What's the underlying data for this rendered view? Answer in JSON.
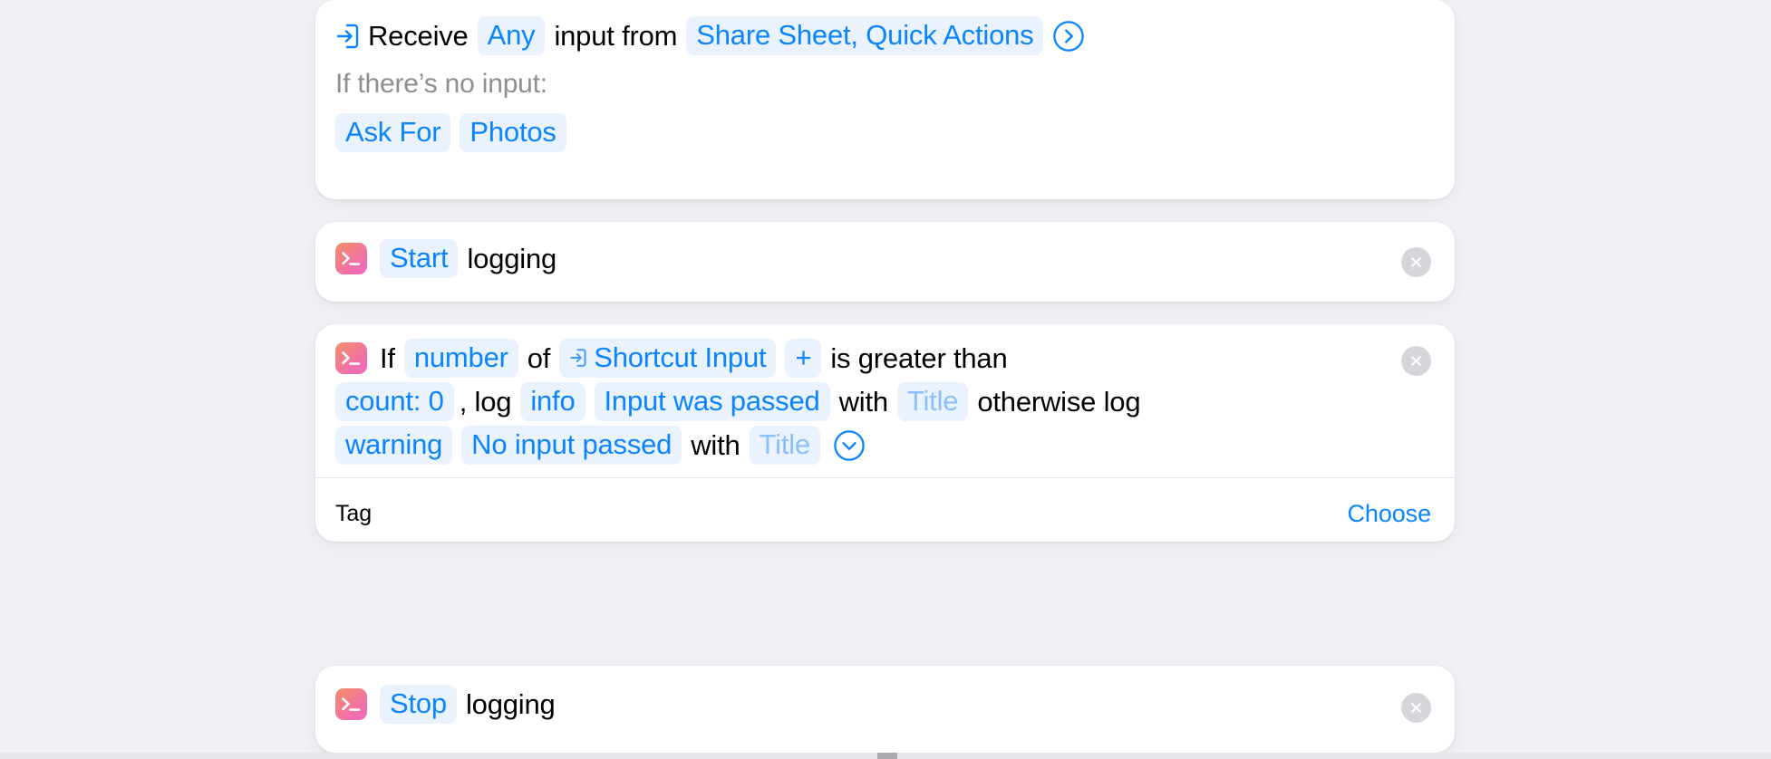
{
  "theme": {
    "page_background": "#f1f1f5",
    "card_background": "#ffffff",
    "accent_blue": "#0a84ff",
    "token_background": "#eaf2fd",
    "placeholder_blue": "#8cc0f8",
    "muted_text": "#8e8e93",
    "remove_button_fill": "#d6d6da",
    "app_icon_gradient_start": "#f3906b",
    "app_icon_gradient_end": "#f06cb8"
  },
  "cards": [
    {
      "id": "shortcut-input-card",
      "icon": "shortcut-input-arrow-icon",
      "line1": [
        {
          "type": "icon",
          "name": "shortcut-input-arrow-icon"
        },
        {
          "type": "plain",
          "text": "Receive"
        },
        {
          "type": "token",
          "text": "Any"
        },
        {
          "type": "plain",
          "text": "input from"
        },
        {
          "type": "token",
          "text": "Share Sheet, Quick Actions"
        },
        {
          "type": "icon",
          "name": "chevron-right-circle-icon"
        }
      ],
      "no_input_label": "If there’s no input:",
      "no_input_tokens": [
        {
          "type": "token",
          "text": "Ask For"
        },
        {
          "type": "token",
          "text": "Photos"
        }
      ]
    },
    {
      "id": "start-logging-card",
      "icon": "terminal-app-icon",
      "tokens": [
        {
          "type": "token",
          "text": "Start"
        },
        {
          "type": "plain",
          "text": "logging"
        }
      ],
      "remove_label": "×"
    },
    {
      "id": "if-log-card",
      "icon": "terminal-app-icon",
      "lines": [
        [
          {
            "type": "appicon",
            "name": "terminal-app-icon"
          },
          {
            "type": "plain",
            "text": "If"
          },
          {
            "type": "token",
            "text": "number"
          },
          {
            "type": "plain",
            "text": "of"
          },
          {
            "type": "token",
            "text": "Shortcut Input",
            "glyph": "shortcut-input-arrow-icon"
          },
          {
            "type": "token",
            "text": "+"
          },
          {
            "type": "plain",
            "text": "is greater than"
          }
        ],
        [
          {
            "type": "token",
            "text": "count: 0"
          },
          {
            "type": "plain",
            "text": ", log"
          },
          {
            "type": "token",
            "text": "info"
          },
          {
            "type": "token",
            "text": "Input was passed"
          },
          {
            "type": "plain",
            "text": "with"
          },
          {
            "type": "token",
            "text": "Title",
            "placeholder": true
          },
          {
            "type": "plain",
            "text": "otherwise log"
          }
        ],
        [
          {
            "type": "token",
            "text": "warning"
          },
          {
            "type": "token",
            "text": "No input passed"
          },
          {
            "type": "plain",
            "text": "with"
          },
          {
            "type": "token",
            "text": "Title",
            "placeholder": true
          },
          {
            "type": "icon",
            "name": "chevron-down-circle-icon"
          }
        ]
      ],
      "detail": {
        "label": "Tag",
        "action": "Choose"
      },
      "remove_label": "×"
    },
    {
      "id": "stop-logging-card",
      "icon": "terminal-app-icon",
      "tokens": [
        {
          "type": "token",
          "text": "Stop"
        },
        {
          "type": "plain",
          "text": "logging"
        }
      ],
      "remove_label": "×"
    }
  ],
  "text": {
    "receive": "Receive",
    "any": "Any",
    "input_from": "input from",
    "share_sheet": "Share Sheet, Quick Actions",
    "no_input": "If there’s no input:",
    "ask_for": "Ask For",
    "photos": "Photos",
    "start": "Start",
    "logging": "logging",
    "if": "If",
    "number": "number",
    "of": "of",
    "shortcut_input": "Shortcut Input",
    "plus": "+",
    "is_greater_than": "is greater than",
    "count_zero": "count: 0",
    "comma_log": ", log",
    "info": "info",
    "input_was_passed": "Input was passed",
    "with": "with",
    "title": "Title",
    "otherwise_log": "otherwise log",
    "warning": "warning",
    "no_input_passed": "No input passed",
    "tag": "Tag",
    "choose": "Choose",
    "stop": "Stop"
  }
}
